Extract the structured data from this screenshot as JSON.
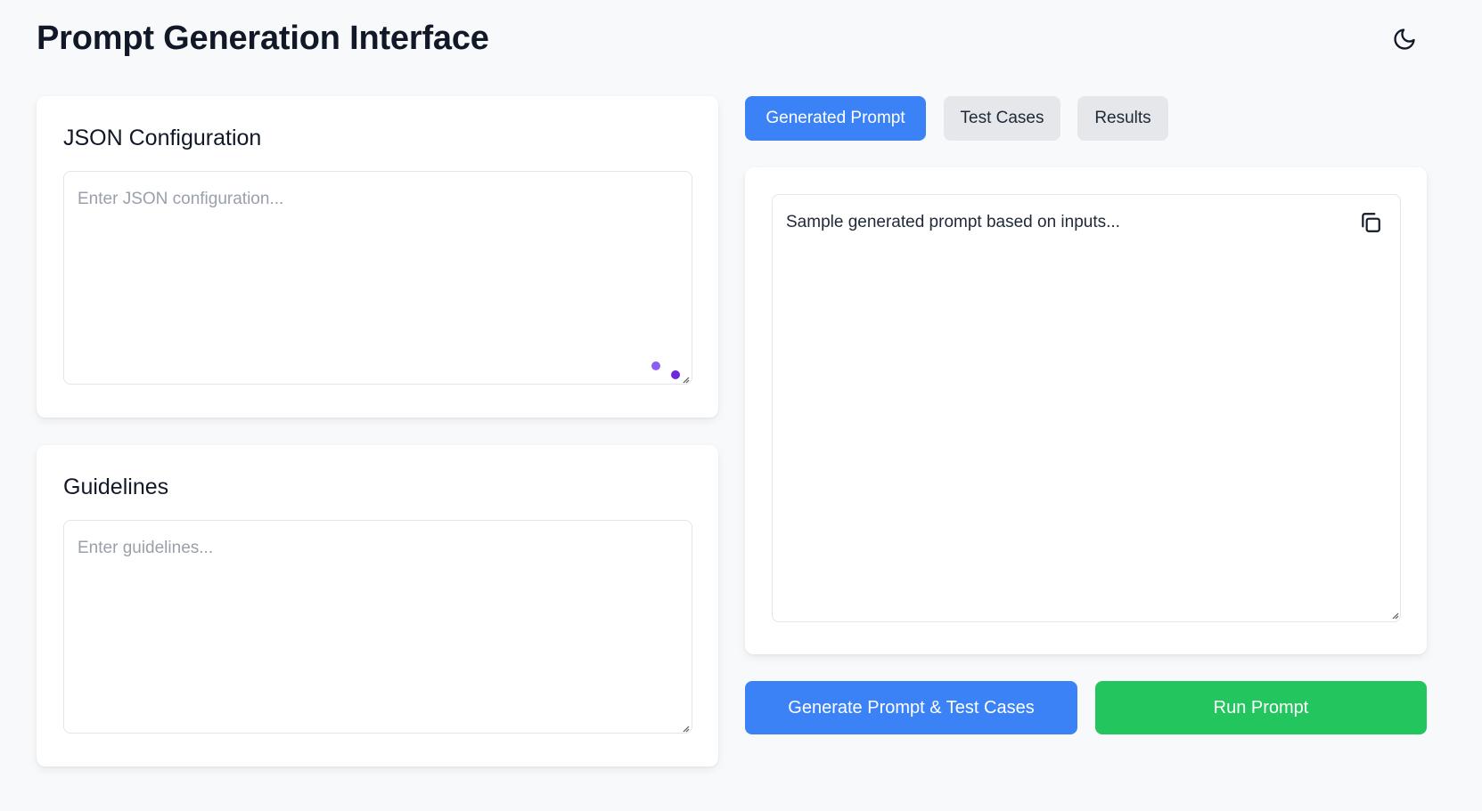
{
  "header": {
    "title": "Prompt Generation Interface",
    "theme_toggle_icon": "moon-icon"
  },
  "json_config": {
    "title": "JSON Configuration",
    "placeholder": "Enter JSON configuration...",
    "value": ""
  },
  "guidelines": {
    "title": "Guidelines",
    "placeholder": "Enter guidelines...",
    "value": ""
  },
  "tabs": [
    {
      "label": "Generated Prompt",
      "active": true
    },
    {
      "label": "Test Cases",
      "active": false
    },
    {
      "label": "Results",
      "active": false
    }
  ],
  "output": {
    "text": "Sample generated prompt based on inputs...",
    "copy_icon": "copy-icon"
  },
  "actions": {
    "generate_label": "Generate Prompt & Test Cases",
    "run_label": "Run Prompt"
  },
  "colors": {
    "primary": "#3b82f6",
    "success": "#22c55e",
    "inactive_tab": "#e5e7eb",
    "background": "#f8f9fb",
    "indicator_dots": "#7c3aed"
  }
}
